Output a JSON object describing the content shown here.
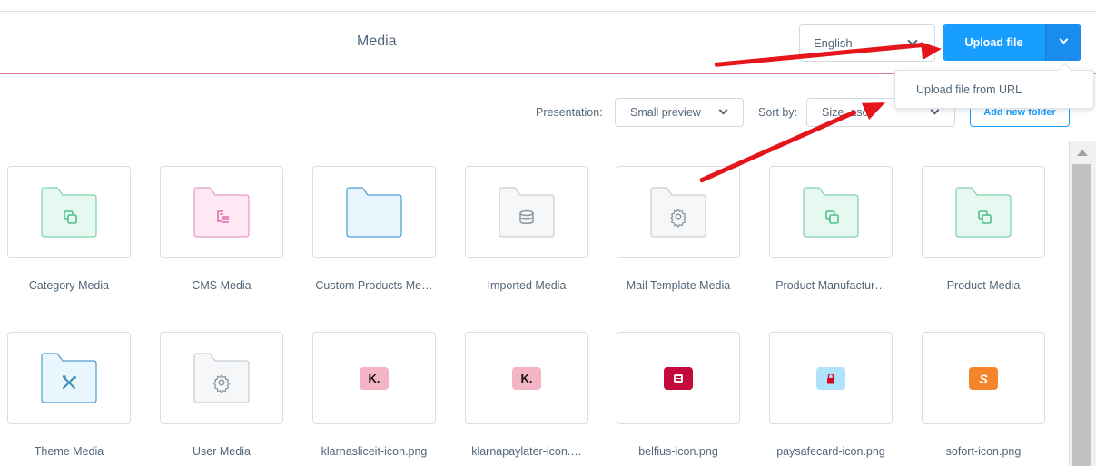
{
  "header": {
    "title": "Media",
    "language": {
      "value": "English"
    },
    "upload_button": "Upload file",
    "upload_menu": {
      "items": [
        "Upload file from URL"
      ]
    }
  },
  "toolbar": {
    "presentation_label": "Presentation:",
    "presentation_value": "Small preview",
    "sort_label": "Sort by:",
    "sort_value": "Size, asc",
    "add_folder_button": "Add new folder"
  },
  "colors": {
    "accent": "#189eff",
    "header_rule": "#e17aa6",
    "annotation_arrow": "#e4161b"
  },
  "items": [
    {
      "label": "Category Media",
      "type": "folder",
      "icon": "copy-icon",
      "theme": "green"
    },
    {
      "label": "CMS Media",
      "type": "folder",
      "icon": "content-list-icon",
      "theme": "pink"
    },
    {
      "label": "Custom Products Me…",
      "type": "folder",
      "icon": "none",
      "theme": "blue"
    },
    {
      "label": "Imported Media",
      "type": "folder",
      "icon": "database-icon",
      "theme": "gray"
    },
    {
      "label": "Mail Template Media",
      "type": "folder",
      "icon": "gear-icon",
      "theme": "gray"
    },
    {
      "label": "Product Manufactur…",
      "type": "folder",
      "icon": "copy-icon",
      "theme": "green"
    },
    {
      "label": "Product Media",
      "type": "folder",
      "icon": "copy-icon",
      "theme": "green"
    },
    {
      "label": "Theme Media",
      "type": "folder",
      "icon": "pencil-ruler-icon",
      "theme": "blue"
    },
    {
      "label": "User Media",
      "type": "folder",
      "icon": "gear-icon",
      "theme": "gray"
    },
    {
      "label": "klarnasliceit-icon.png",
      "type": "file",
      "icon": "klarna-logo-icon",
      "glyph": "K."
    },
    {
      "label": "klarnapaylater-icon.…",
      "type": "file",
      "icon": "klarna-logo-icon",
      "glyph": "K."
    },
    {
      "label": "belfius-icon.png",
      "type": "file",
      "icon": "belfius-logo-icon",
      "glyph": ""
    },
    {
      "label": "paysafecard-icon.png",
      "type": "file",
      "icon": "paysafecard-lock-icon",
      "glyph": ""
    },
    {
      "label": "sofort-icon.png",
      "type": "file",
      "icon": "sofort-logo-icon",
      "glyph": "S"
    }
  ]
}
